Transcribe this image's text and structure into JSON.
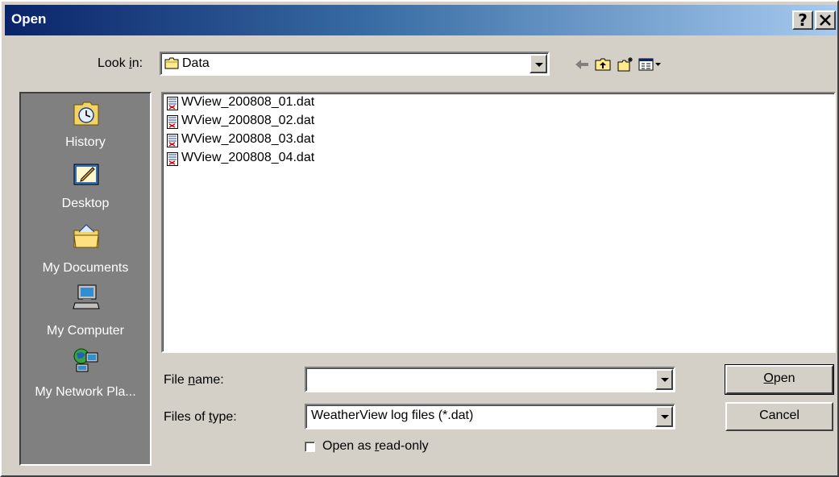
{
  "window": {
    "title": "Open",
    "help_glyph": "?",
    "close_glyph": "✕"
  },
  "look_in": {
    "label_prefix": "Look ",
    "label_accel": "i",
    "label_suffix": "n:",
    "value": "Data"
  },
  "places": [
    {
      "label": "History",
      "icon": "history-icon"
    },
    {
      "label": "Desktop",
      "icon": "desktop-icon"
    },
    {
      "label": "My Documents",
      "icon": "my-documents-icon"
    },
    {
      "label": "My Computer",
      "icon": "my-computer-icon"
    },
    {
      "label": "My Network Pla...",
      "icon": "my-network-places-icon"
    }
  ],
  "files": [
    "WView_200808_01.dat",
    "WView_200808_02.dat",
    "WView_200808_03.dat",
    "WView_200808_04.dat"
  ],
  "file_name": {
    "label_prefix": "File ",
    "label_accel": "n",
    "label_suffix": "ame:",
    "value": ""
  },
  "file_type": {
    "label_prefix": "Files of ",
    "label_accel": "t",
    "label_suffix": "ype:",
    "value": "WeatherView log files (*.dat)"
  },
  "read_only": {
    "label_prefix": "Open as ",
    "label_accel": "r",
    "label_suffix": "ead-only",
    "checked": false
  },
  "buttons": {
    "open_accel": "O",
    "open_rest": "pen",
    "cancel": "Cancel"
  },
  "colors": {
    "title_start": "#0a246a",
    "title_end": "#a6caf0",
    "face": "#d4d0c8",
    "places_bg": "#808080"
  }
}
